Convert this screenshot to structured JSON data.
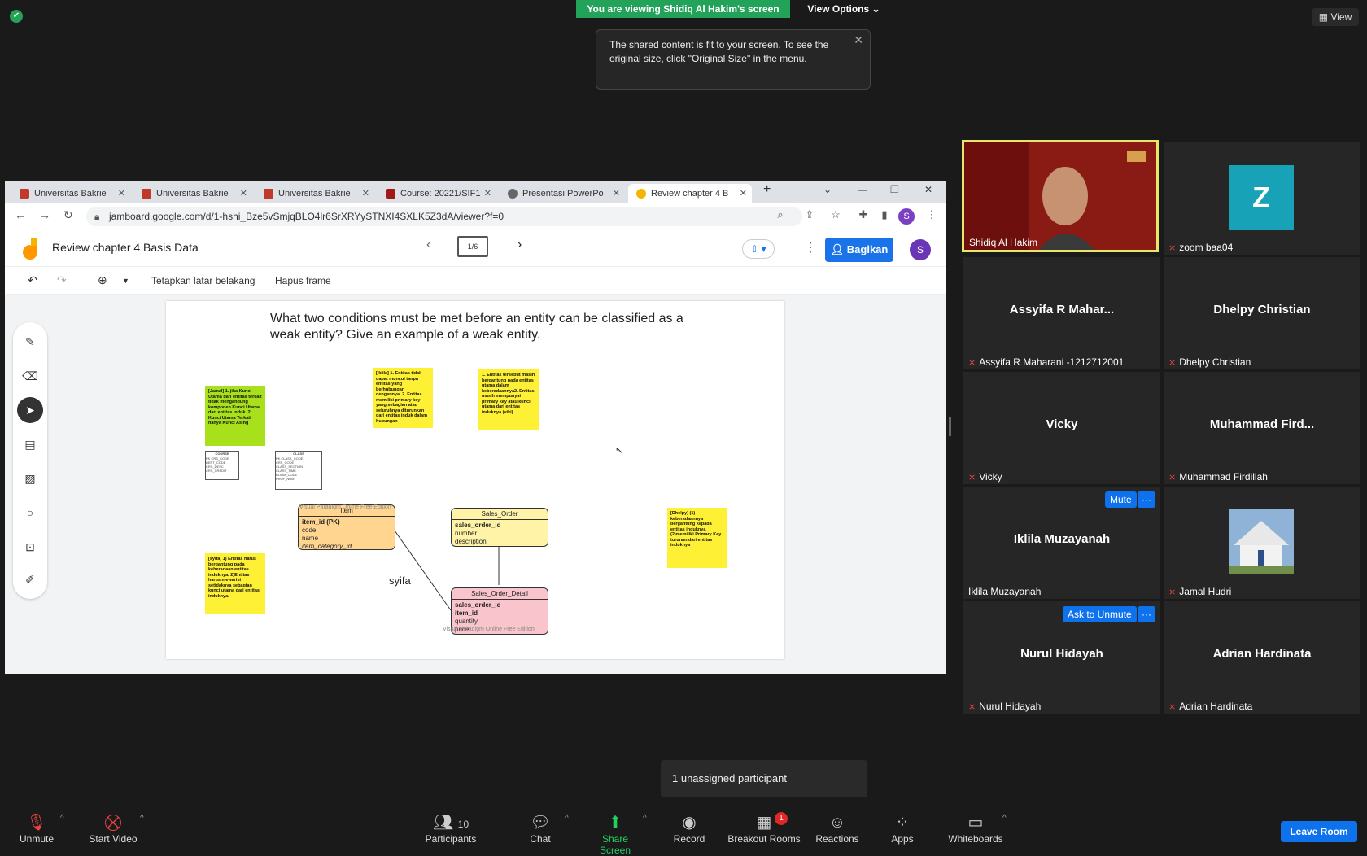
{
  "zoom": {
    "share_banner": "You are viewing Shidiq Al Hakim's screen",
    "view_options": "View Options",
    "view_btn": "View",
    "tooltip": "The shared content is fit to your screen. To see the original size, click \"Original Size\" in the menu.",
    "unassigned": "1 unassigned participant",
    "controls": {
      "unmute": "Unmute",
      "start_video": "Start Video",
      "participants": "Participants",
      "participants_count": "10",
      "chat": "Chat",
      "share_screen": "Share Screen",
      "record": "Record",
      "breakout": "Breakout Rooms",
      "breakout_badge": "1",
      "reactions": "Reactions",
      "apps": "Apps",
      "whiteboards": "Whiteboards",
      "leave": "Leave Room"
    }
  },
  "browser": {
    "tabs": [
      {
        "label": "Universitas Bakrie"
      },
      {
        "label": "Universitas Bakrie"
      },
      {
        "label": "Universitas Bakrie"
      },
      {
        "label": "Course: 20221/SIF1"
      },
      {
        "label": "Presentasi PowerPo"
      },
      {
        "label": "Review chapter 4 B"
      }
    ],
    "url": "jamboard.google.com/d/1-hshi_Bze5vSmjqBLO4lr6SrXRYySTNXI4SXLK5Z3dA/viewer?f=0",
    "profile_letter": "S"
  },
  "jamboard": {
    "title": "Review chapter 4 Basis Data",
    "frame_indicator": "1/6",
    "share_label": "Bagikan",
    "avatar_letter": "S",
    "toolbar": {
      "set_background": "Tetapkan latar belakang",
      "clear_frame": "Hapus frame"
    },
    "question": "What two conditions must be met before an entity can be classified as a weak entity? Give an example of a weak entity.",
    "notes": {
      "jamal": "[Jamal] 1. jika Kunci Utama dari entitas terkait tidak mengandung komponen Kunci Utama dari entitas induk. 2. Kunci Utama Terkait hanya Kunci Asing",
      "iklila": "[Iklila] 1. Entitas tidak dapat muncul tanpa entitas yang berhubungan dengannya. 2. Entitas memiliki primary key yang sebagian atau seluruhnya diturunkan dari entitas induk dalam hubungan",
      "vicky": "1. Entitas tersebut masih bergantung pada entitas utama dalam keberadaannya2. Entitas masih mempunyai primary key atau kunci utama dari entitas induknya (viki)",
      "dhelpy": "[Dhelpy] (1) keberadaannya bergantung kepada entitas induknya (2)memiliki Primary Key turunan dari entitas induknya",
      "syifa": "[syifa] 1) Entitas harus bergantung pada keberadaan entitas induknya. 2)Entitas harus mewarisi setidaknya sebagian kunci utama dari entitas induknya."
    },
    "course_table": {
      "left_title": "COURSE",
      "left_rows": [
        "PK  CRS_CODE",
        "DEPT_CODE",
        "CRS_DESC",
        "CRS_CREDIT"
      ],
      "right_title": "CLASS",
      "right_rows": [
        "PK  CLASS_CODE",
        "CRS_CODE",
        "CLASS_SECTION",
        "CLASS_TIME",
        "ROOM_CODE",
        "PROF_NUM"
      ]
    },
    "item_entity": {
      "title": "Item",
      "rows": [
        "item_id (PK)",
        "code",
        "name",
        "item_category_id"
      ]
    },
    "sales_order": {
      "title": "Sales_Order",
      "rows": [
        "sales_order_id",
        "number",
        "description"
      ]
    },
    "sales_order_detail": {
      "title": "Sales_Order_Detail",
      "rows": [
        "sales_order_id",
        "item_id",
        "quantity",
        "price"
      ]
    },
    "watermark": "Visual Paradigm Online Free Edition",
    "syifa_label": "syifa"
  },
  "participants": [
    {
      "name": "",
      "label": "Shidiq Al Hakim",
      "active": true
    },
    {
      "name": "",
      "label": "zoom baa04",
      "avatar_letter": "Z"
    },
    {
      "name": "Assyifa R Mahar...",
      "label": "Assyifa R Maharani -1212712001"
    },
    {
      "name": "Dhelpy Christian",
      "label": "Dhelpy Christian"
    },
    {
      "name": "Vicky",
      "label": "Vicky"
    },
    {
      "name": "Muhammad  Fird...",
      "label": "Muhammad Firdillah"
    },
    {
      "name": "Iklila Muzayanah",
      "label": "Iklila Muzayanah",
      "action": "Mute"
    },
    {
      "name": "",
      "label": "Jamal Hudri"
    },
    {
      "name": "Nurul Hidayah",
      "label": "Nurul Hidayah",
      "action": "Ask to Unmute"
    },
    {
      "name": "Adrian Hardinata",
      "label": "Adrian Hardinata"
    }
  ],
  "colors": {
    "zoom_green": "#23a35a",
    "zoom_blue": "#0e72ed",
    "sticky_yellow": "#fef035",
    "sticky_green": "#a8e01c"
  }
}
